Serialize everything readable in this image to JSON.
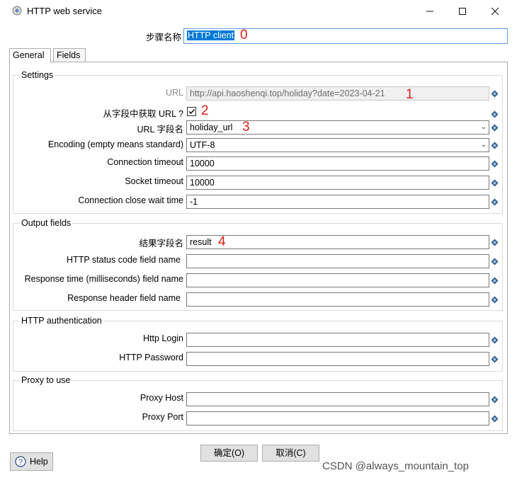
{
  "window": {
    "title": "HTTP web service",
    "min_icon": "minimize-icon",
    "max_icon": "maximize-icon",
    "close_icon": "close-icon"
  },
  "step_name": {
    "label": "步骤名称",
    "value": "HTTP client",
    "marker": "0"
  },
  "tabs": [
    {
      "label": "General"
    },
    {
      "label": "Fields"
    }
  ],
  "settings": {
    "title": "Settings",
    "url": {
      "label": "URL",
      "value": "http://api.haoshenqi.top/holiday?date=2023-04-21",
      "marker": "1"
    },
    "url_from_field": {
      "label": "从字段中获取 URL ?",
      "checked": true,
      "marker": "2"
    },
    "url_field_name": {
      "label": "URL 字段名",
      "value": "holiday_url",
      "marker": "3"
    },
    "encoding": {
      "label": "Encoding (empty means standard)",
      "value": "UTF-8"
    },
    "connection_timeout": {
      "label": "Connection timeout",
      "value": "10000"
    },
    "socket_timeout": {
      "label": "Socket timeout",
      "value": "10000"
    },
    "close_wait": {
      "label": "Connection close wait time",
      "value": "-1"
    }
  },
  "output": {
    "title": "Output fields",
    "result_field": {
      "label": "结果字段名",
      "value": "result",
      "marker": "4"
    },
    "status_code": {
      "label": "HTTP status code field name",
      "value": ""
    },
    "response_time": {
      "label": "Response time (milliseconds) field name",
      "value": ""
    },
    "response_header": {
      "label": "Response header field name",
      "value": ""
    }
  },
  "auth": {
    "title": "HTTP authentication",
    "login": {
      "label": "Http Login",
      "value": ""
    },
    "password": {
      "label": "HTTP Password",
      "value": ""
    }
  },
  "proxy": {
    "title": "Proxy to use",
    "host": {
      "label": "Proxy Host",
      "value": ""
    },
    "port": {
      "label": "Proxy Port",
      "value": ""
    }
  },
  "buttons": {
    "ok": "确定(O)",
    "cancel": "取消(C)",
    "help": "Help"
  },
  "watermark": "CSDN @always_mountain_top"
}
